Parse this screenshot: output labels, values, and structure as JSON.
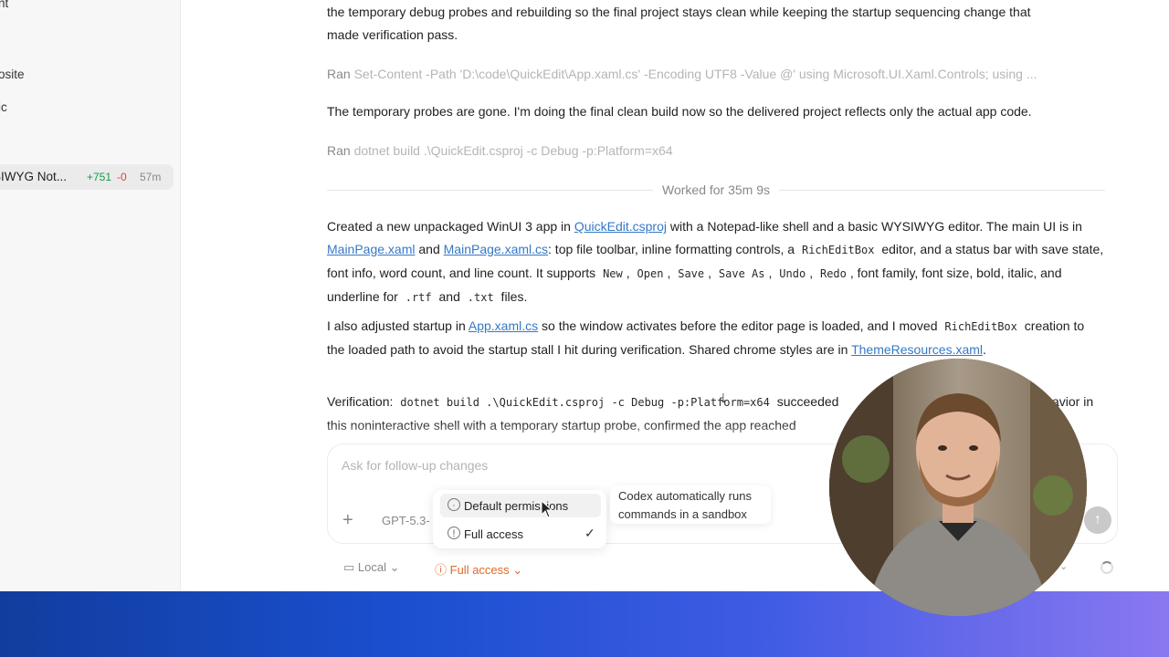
{
  "sidebar": {
    "items": [
      {
        "label": "nt"
      },
      {
        "label": "osite"
      },
      {
        "label": "ic"
      }
    ],
    "active_thread": {
      "title": "SIWYG Not...",
      "added": "+751",
      "removed": "-0",
      "age": "57m"
    }
  },
  "conversation": {
    "intro_line1": "the temporary debug probes and rebuilding so the final project stays clean while keeping the startup sequencing change that",
    "intro_line2": "made verification pass.",
    "ran1_label": "Ran",
    "ran1_cmd": "Set-Content -Path 'D:\\code\\QuickEdit\\App.xaml.cs' -Encoding UTF8 -Value @' using Microsoft.UI.Xaml.Controls; using ...",
    "probes_gone": "The temporary probes are gone. I'm doing the final clean build now so the delivered project reflects only the actual app code.",
    "ran2_label": "Ran",
    "ran2_cmd": "dotnet build .\\QuickEdit.csproj -c Debug -p:Platform=x64",
    "worked_for": "Worked for 35m 9s",
    "summary": {
      "t1": "Created a new unpackaged WinUI 3 app in ",
      "link1": "QuickEdit.csproj",
      "t2": " with a Notepad-like shell and a basic WYSIWYG editor. The main UI is in ",
      "link2": "MainPage.xaml",
      "t3": " and ",
      "link3": "MainPage.xaml.cs",
      "t4": ": top file toolbar, inline formatting controls, a ",
      "code1": "RichEditBox",
      "t5": " editor, and a status bar with save state, font info, word count, and line count. It supports ",
      "code_new": "New",
      "code_open": "Open",
      "code_save": "Save",
      "code_saveas": "Save As",
      "code_undo": "Undo",
      "code_redo": "Redo",
      "t6": ", font family, font size, bold, italic, and underline for ",
      "code_rtf": ".rtf",
      "t7": " and ",
      "code_txt": ".txt",
      "t8": " files."
    },
    "startup": {
      "t1": "I also adjusted startup in ",
      "link1": "App.xaml.cs",
      "t2": " so the window activates before the editor page is loaded, and I moved ",
      "code1": "RichEditBox",
      "t3": " creation to the loaded path to avoid the startup stall I hit during verification. Shared chrome styles are in ",
      "link2": "ThemeResources.xaml",
      "t4": "."
    },
    "verification": {
      "label": "Verification:",
      "code": "dotnet build .\\QuickEdit.csproj -c Debug -p:Platform=x64",
      "t1": " succeeded",
      "t2": "avior in",
      "line2": "this noninteractive shell with a temporary startup probe, confirmed the app reached"
    }
  },
  "composer": {
    "placeholder": "Ask for follow-up changes",
    "model": "GPT-5.3-",
    "menu": {
      "opt1": "Default permissions",
      "opt2": "Full access",
      "checkmark": "✓"
    },
    "tooltip": "Codex automatically runs commands in a sandbox",
    "env_label": "Local",
    "access_label": "Full access"
  },
  "colors": {
    "link": "#3578c6",
    "added": "#1a9a4a",
    "removed": "#d24a3c",
    "warning": "#e06a2a",
    "banner_start": "#113d9e",
    "banner_end": "#8a78f0"
  }
}
